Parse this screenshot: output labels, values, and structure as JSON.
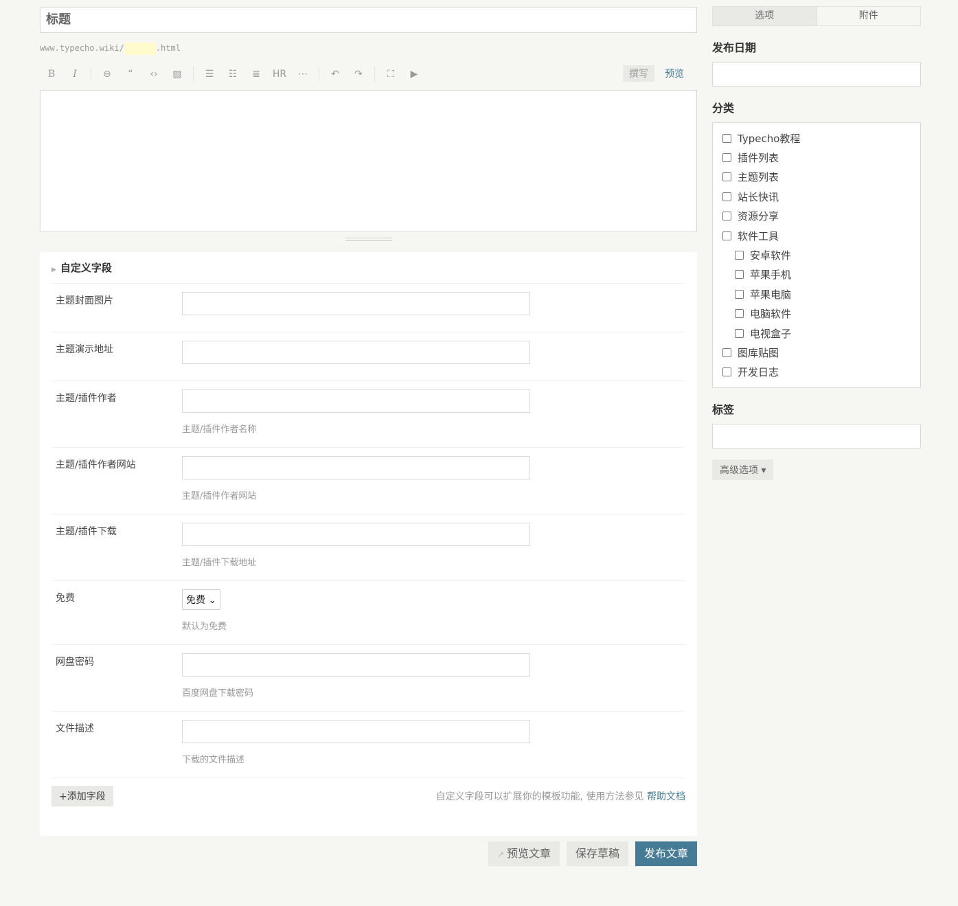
{
  "title": {
    "placeholder": "标题"
  },
  "slug": {
    "prefix": "www.typecho.wiki/",
    "suffix": ".html"
  },
  "toolbar": {
    "icons": [
      {
        "name": "bold-icon",
        "glyph": "B"
      },
      {
        "name": "italic-icon",
        "glyph": "I"
      },
      {
        "name": "link-icon",
        "glyph": "⊖"
      },
      {
        "name": "quote-icon",
        "glyph": "“"
      },
      {
        "name": "code-icon",
        "glyph": "‹›"
      },
      {
        "name": "image-icon",
        "glyph": "▨"
      },
      {
        "name": "ordered-list-icon",
        "glyph": "☰"
      },
      {
        "name": "unordered-list-icon",
        "glyph": "☷"
      },
      {
        "name": "heading-icon",
        "glyph": "≣"
      },
      {
        "name": "hr-icon",
        "glyph": "HR"
      },
      {
        "name": "more-icon",
        "glyph": "⋯"
      },
      {
        "name": "undo-icon",
        "glyph": "↶"
      },
      {
        "name": "redo-icon",
        "glyph": "↷"
      },
      {
        "name": "fullscreen-icon",
        "glyph": "⛶"
      },
      {
        "name": "media-icon",
        "glyph": "▶"
      }
    ],
    "write": "撰写",
    "preview": "预览"
  },
  "custom": {
    "heading": "自定义字段",
    "fields": [
      {
        "label": "主题封面图片",
        "hint": ""
      },
      {
        "label": "主题演示地址",
        "hint": ""
      },
      {
        "label": "主题/插件作者",
        "hint": "主题/插件作者名称"
      },
      {
        "label": "主题/插件作者网站",
        "hint": "主题/插件作者网站"
      },
      {
        "label": "主题/插件下载",
        "hint": "主题/插件下载地址"
      },
      {
        "label": "免费",
        "select": "免费",
        "hint": "默认为免费"
      },
      {
        "label": "网盘密码",
        "hint": "百度网盘下载密码"
      },
      {
        "label": "文件描述",
        "hint": "下载的文件描述"
      }
    ],
    "add": "+添加字段",
    "help": "自定义字段可以扩展你的模板功能, 使用方法参见 ",
    "help_link": "帮助文档"
  },
  "actions": {
    "preview": "预览文章",
    "save": "保存草稿",
    "publish": "发布文章"
  },
  "sidebar": {
    "tabs": [
      "选项",
      "附件"
    ],
    "date_label": "发布日期",
    "category_label": "分类",
    "categories": [
      {
        "name": "Typecho教程",
        "sub": false
      },
      {
        "name": "插件列表",
        "sub": false
      },
      {
        "name": "主题列表",
        "sub": false
      },
      {
        "name": "站长快讯",
        "sub": false
      },
      {
        "name": "资源分享",
        "sub": false
      },
      {
        "name": "软件工具",
        "sub": false
      },
      {
        "name": "安卓软件",
        "sub": true
      },
      {
        "name": "苹果手机",
        "sub": true
      },
      {
        "name": "苹果电脑",
        "sub": true
      },
      {
        "name": "电脑软件",
        "sub": true
      },
      {
        "name": "电视盒子",
        "sub": true
      },
      {
        "name": "图库贴图",
        "sub": false
      },
      {
        "name": "开发日志",
        "sub": false
      }
    ],
    "tags_label": "标签",
    "advanced": "高级选项 ▾"
  },
  "colors": {
    "accent": "#467b96",
    "background": "#f6f6f3"
  }
}
